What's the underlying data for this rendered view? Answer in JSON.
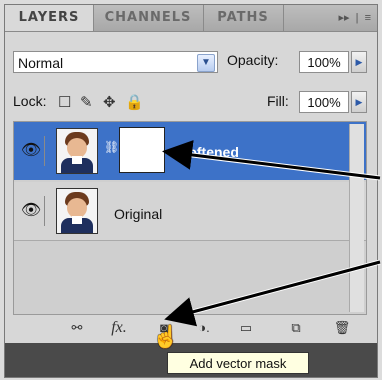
{
  "tabs": [
    {
      "label": "LAYERS",
      "active": true
    },
    {
      "label": "CHANNELS",
      "active": false
    },
    {
      "label": "PATHS",
      "active": false
    }
  ],
  "tab_icons": {
    "collapse": "▸▸",
    "menu": "≡"
  },
  "blend_mode": {
    "value": "Normal"
  },
  "opacity": {
    "label": "Opacity:",
    "value": "100%"
  },
  "lock": {
    "label": "Lock:"
  },
  "fill": {
    "label": "Fill:",
    "value": "100%"
  },
  "layers": [
    {
      "name": "Softened",
      "selected": true,
      "has_mask": true
    },
    {
      "name": "Original",
      "selected": false,
      "has_mask": false
    }
  ],
  "toolbar_icons": [
    "link-layers-icon",
    "fx-icon",
    "add-mask-icon",
    "adjustment-icon",
    "folder-icon",
    "new-layer-icon",
    "trash-icon"
  ],
  "tooltip": {
    "text": "Add vector mask"
  },
  "colors": {
    "selection": "#3d72c8",
    "arrow": "#000000"
  }
}
